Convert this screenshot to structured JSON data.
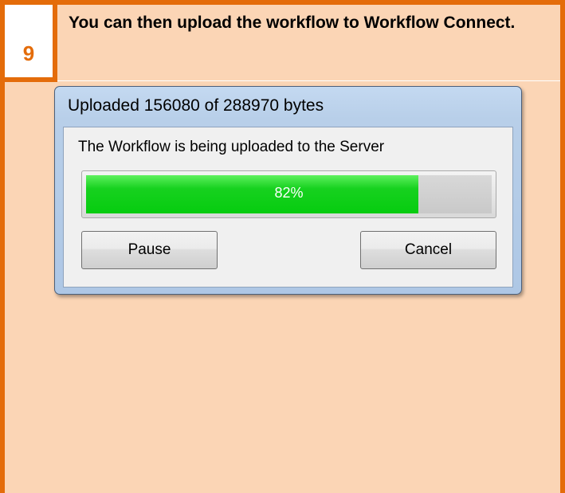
{
  "step": {
    "number": "9",
    "text": "You can then upload the workflow to Workflow Connect."
  },
  "dialog": {
    "title": "Uploaded 156080 of 288970 bytes",
    "message": "The Workflow is being uploaded to the Server",
    "progress_percent": 82,
    "progress_label": "82%",
    "pause_label": "Pause",
    "cancel_label": "Cancel"
  },
  "colors": {
    "accent": "#e46c0a",
    "panel_background": "#fbd5b5",
    "progress_fill": "#06cc0f"
  }
}
